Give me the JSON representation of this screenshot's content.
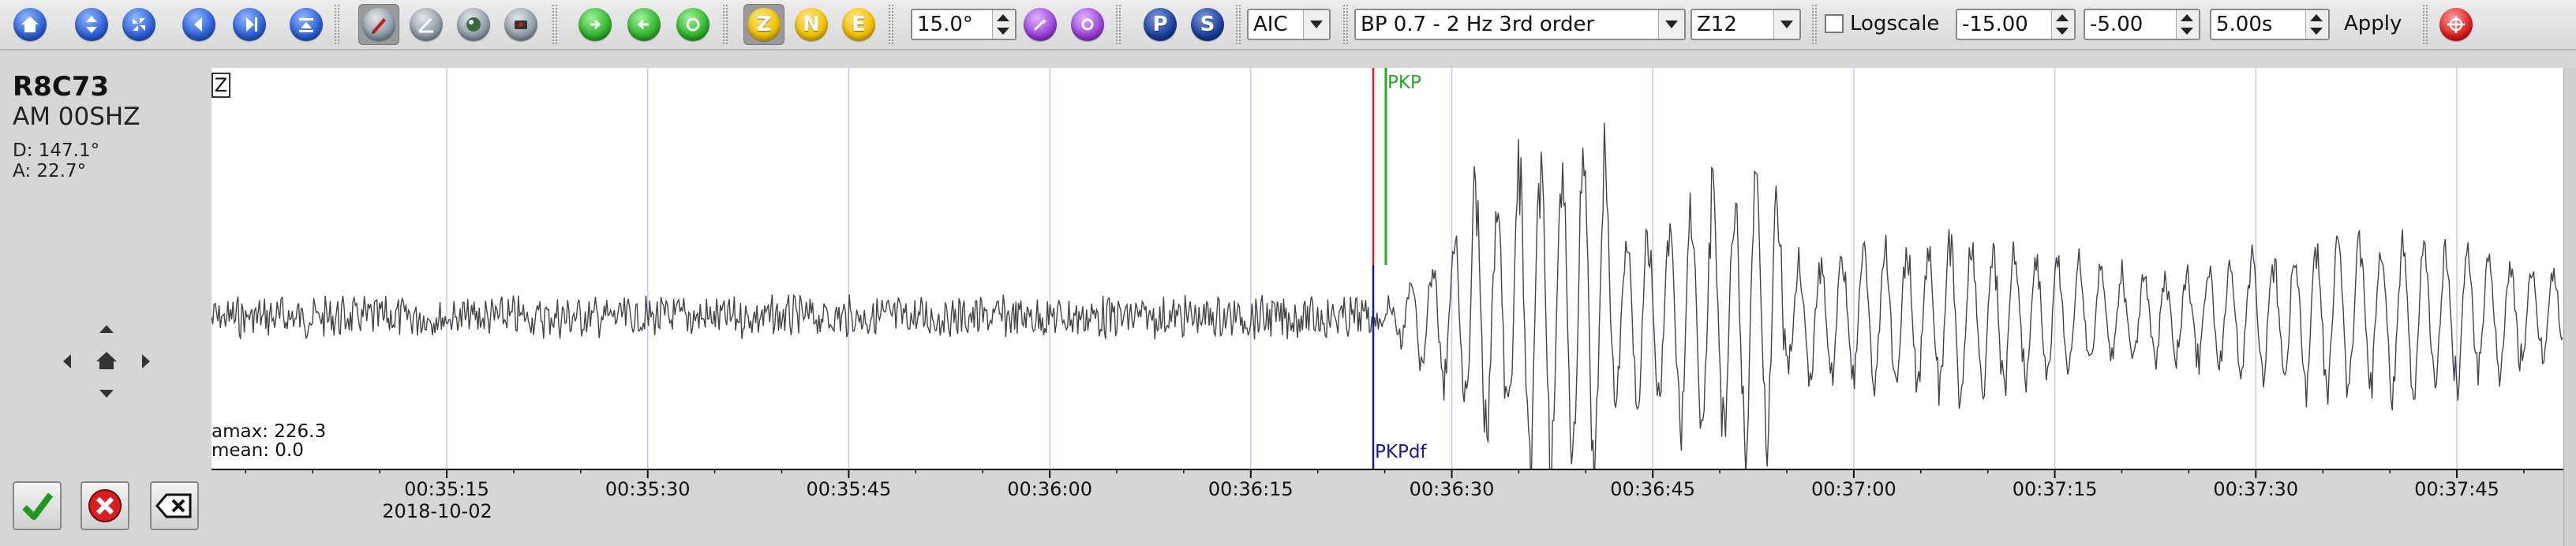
{
  "toolbar": {
    "buttons": [
      {
        "name": "home-button",
        "icon": "home-icon",
        "style": "blue",
        "symbol": "⌂"
      },
      {
        "name": "expand-vertical-button",
        "icon": "expand-vertical-icon",
        "style": "blue",
        "symbol": "⇕"
      },
      {
        "name": "shrink-vertical-button",
        "icon": "shrink-vertical-icon",
        "style": "blue",
        "symbol": "⤧"
      },
      {
        "name": "scroll-left-button",
        "icon": "scroll-left-icon",
        "style": "blue",
        "symbol": "◀"
      },
      {
        "name": "scroll-right-button",
        "icon": "scroll-right-icon",
        "style": "blue",
        "symbol": "▶"
      },
      {
        "name": "align-button",
        "icon": "align-icon",
        "style": "blue",
        "symbol": "⇟"
      },
      {
        "name": "compass-button",
        "icon": "compass-icon",
        "style": "gray",
        "symbol": "✎"
      },
      {
        "name": "measure-angle-button",
        "icon": "measure-angle-icon",
        "style": "gray",
        "symbol": "∠"
      },
      {
        "name": "map-button",
        "icon": "map-icon",
        "style": "gray",
        "symbol": "◉"
      },
      {
        "name": "record-button",
        "icon": "record-icon",
        "style": "gray",
        "symbol": "●"
      },
      {
        "name": "green-pick-button",
        "icon": "pick-add-icon",
        "style": "green",
        "symbol": "⟳"
      },
      {
        "name": "green-swap-button",
        "icon": "pick-swap-icon",
        "style": "green",
        "symbol": "⇄"
      },
      {
        "name": "green-rotate-button",
        "icon": "rotate-icon",
        "style": "green",
        "symbol": "↻"
      }
    ],
    "components": [
      "Z",
      "N",
      "E"
    ],
    "filter_window": "15.0°",
    "picker_method": "AIC",
    "filter": "BP 0.7 - 2 Hz  3rd order",
    "rotation": "Z12",
    "logscale_label": "Logscale",
    "logscale_checked": false,
    "time_min": "-15.00",
    "time_max": "-5.00",
    "time_window": "5.00s",
    "apply_label": "Apply",
    "phase_p": "P",
    "phase_s": "S"
  },
  "station": {
    "code": "R8C73",
    "network_channel": "AM  00SHZ",
    "distance": "D:  147.1°",
    "azimuth": "A:  22.7°"
  },
  "trace": {
    "component_label": "Z",
    "amax": "amax: 226.3",
    "mean": "mean: 0.0",
    "pick_manual": "PKP",
    "pick_theoretical": "PKPdf",
    "colors": {
      "manual": "#22aa22",
      "theoretical": "#1a1a8c",
      "cursor": "#dd2222",
      "trace": "#444444",
      "grid": "#c8c8f0"
    }
  },
  "axis": {
    "ticks": [
      "00:35:15",
      "00:35:30",
      "00:35:45",
      "00:36:00",
      "00:36:15",
      "00:36:30",
      "00:36:45",
      "00:37:00",
      "00:37:15",
      "00:37:30",
      "00:37:45"
    ],
    "date": "2018-10-02"
  }
}
